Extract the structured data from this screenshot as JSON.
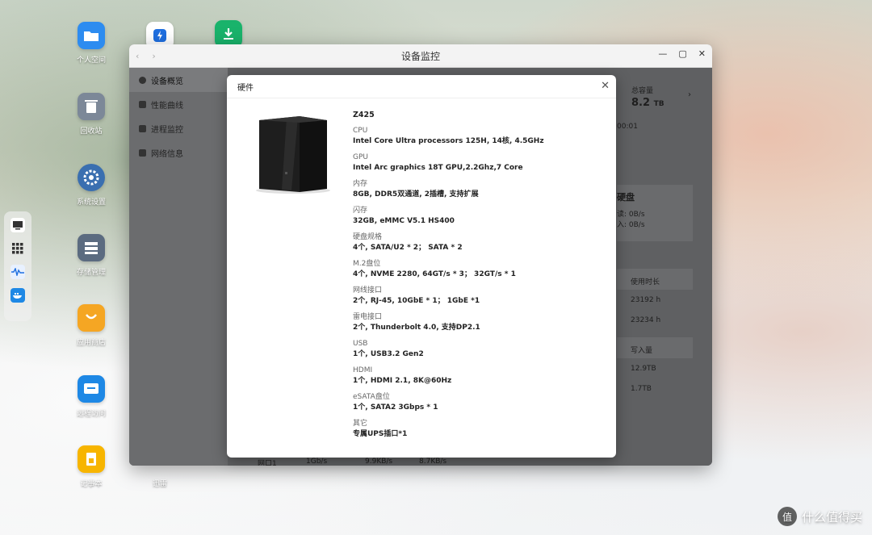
{
  "desktop": {
    "icons": [
      {
        "label": "个人空间",
        "icon": "folder-icon",
        "color": "#2d8cf0"
      },
      {
        "label": "回收站",
        "icon": "trash-icon",
        "color": "#7c8898"
      },
      {
        "label": "系统设置",
        "icon": "gear-icon",
        "color": "#3a6fb0"
      },
      {
        "label": "存储管理",
        "icon": "storage-icon",
        "color": "#5b6b80"
      },
      {
        "label": "应用商店",
        "icon": "store-icon",
        "color": "#f5a623"
      },
      {
        "label": "远程访问",
        "icon": "remote-icon",
        "color": "#1e88e5"
      },
      {
        "label": "记事本",
        "icon": "notepad-icon",
        "color": "#f7b500"
      },
      {
        "label": "迅雷",
        "icon": "thunder-icon",
        "color": "#2f7de1"
      }
    ],
    "top_icons": [
      {
        "icon": "bolt-app-icon",
        "color": "#1e6fe0"
      },
      {
        "icon": "download-app-icon",
        "color": "#19b36b"
      }
    ],
    "dock": [
      "monitor-icon",
      "apps-grid-icon",
      "wave-icon",
      "docker-icon"
    ]
  },
  "window": {
    "title": "设备监控",
    "sidebar": [
      {
        "label": "设备概览",
        "active": true
      },
      {
        "label": "性能曲线",
        "active": false
      },
      {
        "label": "进程监控",
        "active": false
      },
      {
        "label": "网络信息",
        "active": false
      }
    ],
    "background": {
      "total_capacity_label": "总容量",
      "total_capacity_value": "8.2",
      "total_capacity_unit": "TB",
      "uptime_fragment": "00:01",
      "disk_title_fragment": "硬盘",
      "read_fragment": "读: 0B/s",
      "write_fragment": "入: 0B/s",
      "usage_time_header": "使用时长",
      "usage_rows": [
        "23192 h",
        "23234 h"
      ],
      "write_header": "写入量",
      "write_rows": [
        "12.9TB",
        "1.7TB"
      ],
      "net_row": [
        "网口1",
        "1Gb/s",
        "9.9KB/s",
        "8.7KB/s"
      ],
      "under_dialog_label": "迅雷"
    }
  },
  "dialog": {
    "title": "硬件",
    "model": "Z425",
    "specs": [
      {
        "key": "CPU",
        "value": "Intel Core Ultra processors 125H, 14核, 4.5GHz"
      },
      {
        "key": "GPU",
        "value": "Intel Arc graphics 18T GPU,2.2Ghz,7 Core"
      },
      {
        "key": "内存",
        "value": "8GB, DDR5双通道, 2插槽, 支持扩展"
      },
      {
        "key": "闪存",
        "value": "32GB, eMMC V5.1 HS400"
      },
      {
        "key": "硬盘规格",
        "value": "4个, SATA/U2 * 2；  SATA * 2"
      },
      {
        "key": "M.2盘位",
        "value": "4个, NVME 2280, 64GT/s * 3；  32GT/s * 1"
      },
      {
        "key": "网线接口",
        "value": "2个, RJ-45, 10GbE * 1；  1GbE *1"
      },
      {
        "key": "雷电接口",
        "value": "2个, Thunderbolt 4.0, 支持DP2.1"
      },
      {
        "key": "USB",
        "value": "1个, USB3.2 Gen2"
      },
      {
        "key": "HDMI",
        "value": "1个, HDMI 2.1, 8K@60Hz"
      },
      {
        "key": "eSATA盘位",
        "value": "1个, SATA2 3Gbps * 1"
      },
      {
        "key": "其它",
        "value": "专属UPS插口*1"
      }
    ]
  },
  "watermark": {
    "text": "什么值得买",
    "badge": "值"
  }
}
